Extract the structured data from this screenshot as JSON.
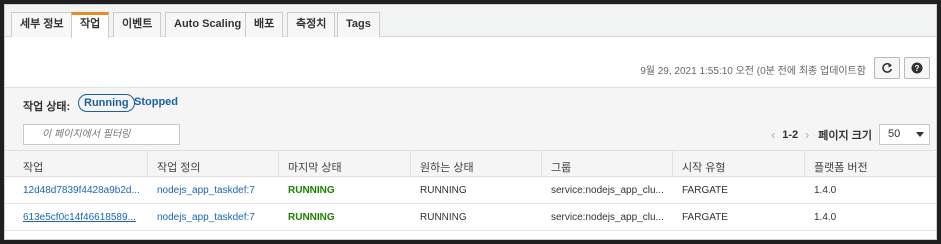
{
  "tabs": [
    "세부 정보",
    "작업",
    "이벤트",
    "Auto Scaling",
    "배포",
    "측정치",
    "Tags"
  ],
  "active_tab": "작업",
  "timestamp": "9월 29, 2021 1:55:10 오전 (0분 전에 최종 업데이트함",
  "filter": {
    "label": "작업 상태:",
    "options": [
      "Running",
      "Stopped"
    ],
    "selected": "Running"
  },
  "search": {
    "placeholder": "이 페이지에서 필터링"
  },
  "pager": {
    "prev": "‹",
    "range": "1-2",
    "next": "›",
    "page_size_label": "페이지 크기",
    "page_size": "50"
  },
  "columns": [
    "작업",
    "작업 정의",
    "마지막 상태",
    "원하는 상태",
    "그룹",
    "시작 유형",
    "플랫폼 버전"
  ],
  "rows": [
    {
      "task": "12d48d7839f4428a9b2d...",
      "task_def": "nodejs_app_taskdef:7",
      "last_status": "RUNNING",
      "desired_status": "RUNNING",
      "group": "service:nodejs_app_clu...",
      "launch_type": "FARGATE",
      "platform": "1.4.0"
    },
    {
      "task": "613e5cf0c14f46618589...",
      "task_def": "nodejs_app_taskdef:7",
      "last_status": "RUNNING",
      "desired_status": "RUNNING",
      "group": "service:nodejs_app_clu...",
      "launch_type": "FARGATE",
      "platform": "1.4.0"
    }
  ],
  "colors": {
    "accent": "#e88a27",
    "link": "#1a66b3",
    "running": "#1d8102"
  }
}
